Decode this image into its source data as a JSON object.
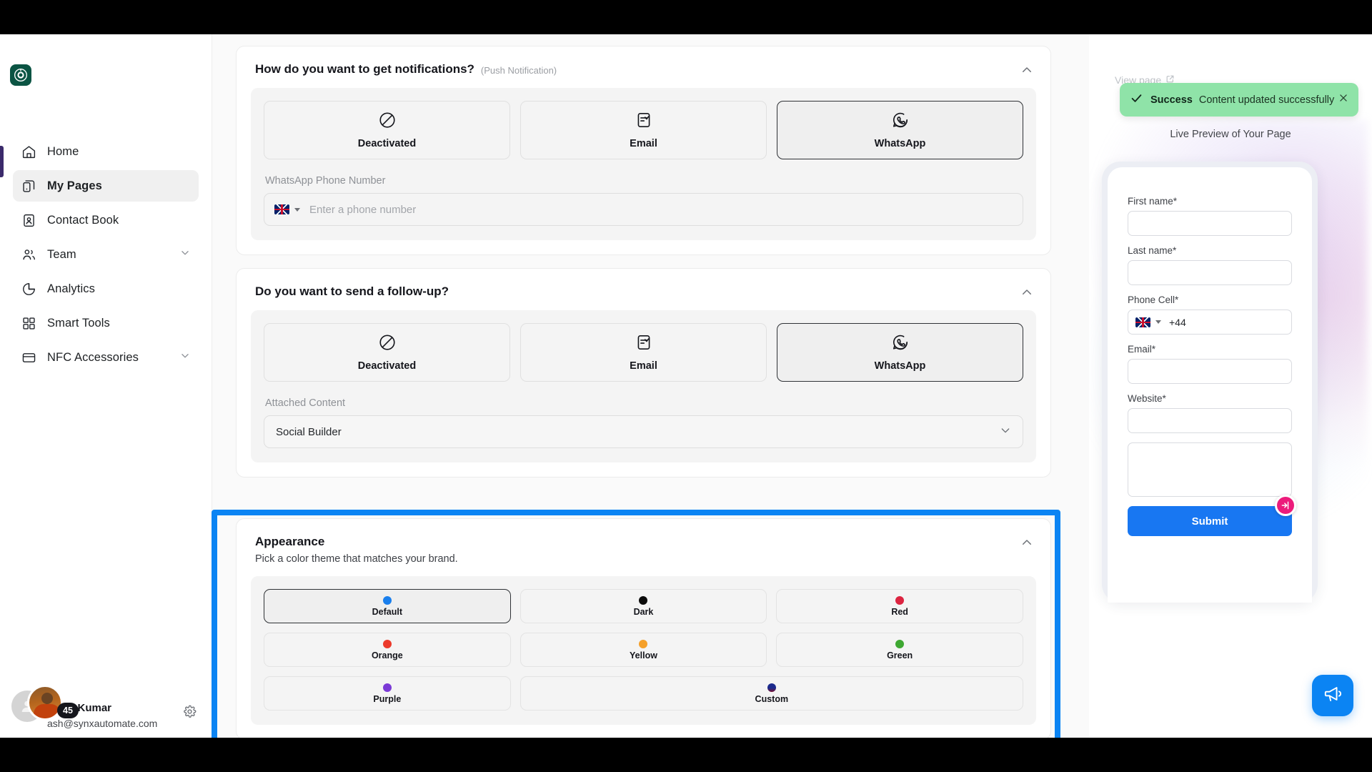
{
  "sidebar": {
    "logo_icon": "brand-circle-logo",
    "items": [
      {
        "label": "Home",
        "icon": "home-icon",
        "active": false,
        "expandable": false
      },
      {
        "label": "My Pages",
        "icon": "pages-icon",
        "active": true,
        "expandable": false
      },
      {
        "label": "Contact Book",
        "icon": "contact-book-icon",
        "active": false,
        "expandable": false
      },
      {
        "label": "Team",
        "icon": "users-icon",
        "active": false,
        "expandable": true
      },
      {
        "label": "Analytics",
        "icon": "pie-chart-icon",
        "active": false,
        "expandable": true
      },
      {
        "label": "Smart Tools",
        "icon": "grid-icon",
        "active": false,
        "expandable": false
      },
      {
        "label": "NFC Accessories",
        "icon": "card-icon",
        "active": false,
        "expandable": true
      }
    ],
    "user": {
      "name": "y Kumar",
      "email": "ash@synxautomate.com",
      "badge_count": "45",
      "settings_icon": "gear-icon"
    },
    "accent_color": "#3b2a6b"
  },
  "notifications_section": {
    "title": "How do you want to get notifications?",
    "subtitle": "(Push Notification)",
    "collapse_icon": "chevron-up-icon",
    "options": [
      {
        "label": "Deactivated",
        "icon": "no-entry-icon",
        "selected": false
      },
      {
        "label": "Email",
        "icon": "email-icon",
        "selected": false
      },
      {
        "label": "WhatsApp",
        "icon": "whatsapp-icon",
        "selected": true
      }
    ],
    "phone_field": {
      "label": "WhatsApp Phone Number",
      "placeholder": "Enter a phone number",
      "value": "",
      "country_flag": "uk-flag-icon"
    }
  },
  "followup_section": {
    "title": "Do you want to send a follow-up?",
    "collapse_icon": "chevron-up-icon",
    "options": [
      {
        "label": "Deactivated",
        "icon": "no-entry-icon",
        "selected": false
      },
      {
        "label": "Email",
        "icon": "email-icon",
        "selected": false
      },
      {
        "label": "WhatsApp",
        "icon": "whatsapp-icon",
        "selected": true
      }
    ],
    "attached": {
      "label": "Attached Content",
      "value": "Social Builder",
      "chevron_icon": "chevron-down-icon"
    }
  },
  "appearance_section": {
    "title": "Appearance",
    "description": "Pick a color theme that matches your brand.",
    "collapse_icon": "chevron-up-icon",
    "highlight_color": "#0b84f3",
    "themes": [
      {
        "label": "Default",
        "color": "#1a7fed",
        "selected": true,
        "wide": false
      },
      {
        "label": "Dark",
        "color": "#0b0b0b",
        "selected": false,
        "wide": false
      },
      {
        "label": "Red",
        "color": "#dc2440",
        "selected": false,
        "wide": false
      },
      {
        "label": "Orange",
        "color": "#ec3a2b",
        "selected": false,
        "wide": false
      },
      {
        "label": "Yellow",
        "color": "#f5a02a",
        "selected": false,
        "wide": false
      },
      {
        "label": "Green",
        "color": "#3ea832",
        "selected": false,
        "wide": false
      },
      {
        "label": "Purple",
        "color": "#7b3ad6",
        "selected": false,
        "wide": false
      },
      {
        "label": "Custom",
        "color": "#1b2a8c",
        "selected": false,
        "wide": true
      }
    ]
  },
  "toast": {
    "title": "Success",
    "message": "Content updated successfully",
    "check_icon": "check-icon",
    "close_icon": "close-icon",
    "background": "#8fe3a8"
  },
  "view_page_link": {
    "label": "View page",
    "icon": "external-link-icon"
  },
  "preview": {
    "caption": "Live Preview of Your Page",
    "fields": [
      {
        "label": "First name*",
        "type": "text",
        "value": ""
      },
      {
        "label": "Last name*",
        "type": "text",
        "value": ""
      },
      {
        "label": "Phone Cell*",
        "type": "phone",
        "value": "+44",
        "country_flag": "uk-flag-icon"
      },
      {
        "label": "Email*",
        "type": "text",
        "value": ""
      },
      {
        "label": "Website*",
        "type": "text",
        "value": ""
      },
      {
        "label": "",
        "type": "textarea",
        "value": ""
      }
    ],
    "submit_label": "Submit",
    "submit_color": "#1877f2",
    "badge_icon": "arrow-in-circle-icon",
    "badge_color": "#ec1b7b"
  },
  "chat_widget": {
    "icon": "megaphone-icon",
    "color": "#0b84f3"
  }
}
